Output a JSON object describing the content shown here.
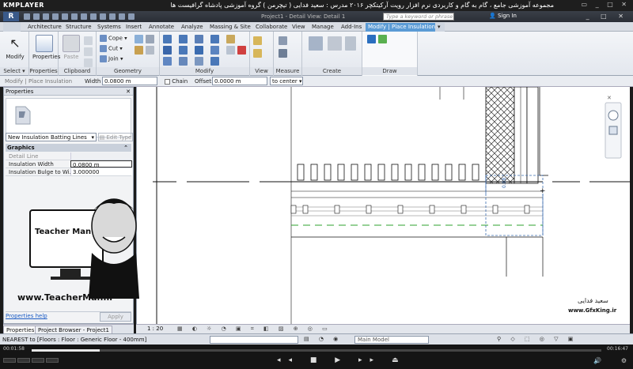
{
  "player": {
    "brand": "KMPLAYER",
    "title": "مجموعه آموزشی جامع ، گام به گام و کاربردی نرم افزار رویت آرکیتکچر ۲۰۱۶ مدرس : سعید فدایی ( تیچرمن ) گروه آموزشی پادشاه گرافیست ها",
    "time_elapsed": "00:01:58",
    "time_total": "00:16:47",
    "progress_fraction": 0.12
  },
  "revit": {
    "doc_title": "Project1 - Detail View: Detail 1",
    "search_placeholder": "Type a keyword or phrase",
    "sign_in": "Sign In",
    "tabs": [
      "Architecture",
      "Structure",
      "Systems",
      "Insert",
      "Annotate",
      "Analyze",
      "Massing & Site",
      "Collaborate",
      "View",
      "Manage",
      "Add-Ins",
      "Modify | Place Insulation"
    ],
    "ribbon": {
      "select_label": "Select",
      "modify_label": "Modify",
      "properties_label": "Properties",
      "clipboard_label": "Clipboard",
      "paste_label": "Paste",
      "geometry_label": "Geometry",
      "cope_label": "Cope",
      "cut_label": "Cut",
      "join_label": "Join",
      "modify_panel_label": "Modify",
      "view_label": "View",
      "measure_label": "Measure",
      "create_label": "Create",
      "draw_label": "Draw"
    },
    "options_bar": {
      "context": "Modify | Place Insulation",
      "width_label": "Width",
      "width_value": "0.0800 m",
      "chain_label": "Chain",
      "offset_label": "Offset:",
      "offset_value": "0.0000 m",
      "placement": "to center"
    },
    "properties": {
      "header": "Properties",
      "type": "New Insulation Batting Lines",
      "edit_type": "Edit Type",
      "section": "Graphics",
      "rows": [
        {
          "key": "Detail Line",
          "value": ""
        },
        {
          "key": "Insulation Width",
          "value": "0.0800 m"
        },
        {
          "key": "Insulation Bulge to Wi...",
          "value": "3.000000"
        }
      ],
      "help": "Properties help",
      "apply": "Apply"
    },
    "bottom_tabs": [
      "Properties",
      "Project Browser - Project1"
    ],
    "view": {
      "scale": "1 : 20",
      "dimension": "0.08"
    },
    "status": {
      "message": "NEAREST  to [Floors : Floor : Generic Floor - 400mm]",
      "model": "Main Model"
    }
  },
  "overlay": {
    "teacher_logo": "Teacher Man",
    "teacher_site": "www.TeacherMan.ir",
    "author_fa": "سعید فدایی",
    "gfx_site": "www.GfxKing.ir"
  }
}
